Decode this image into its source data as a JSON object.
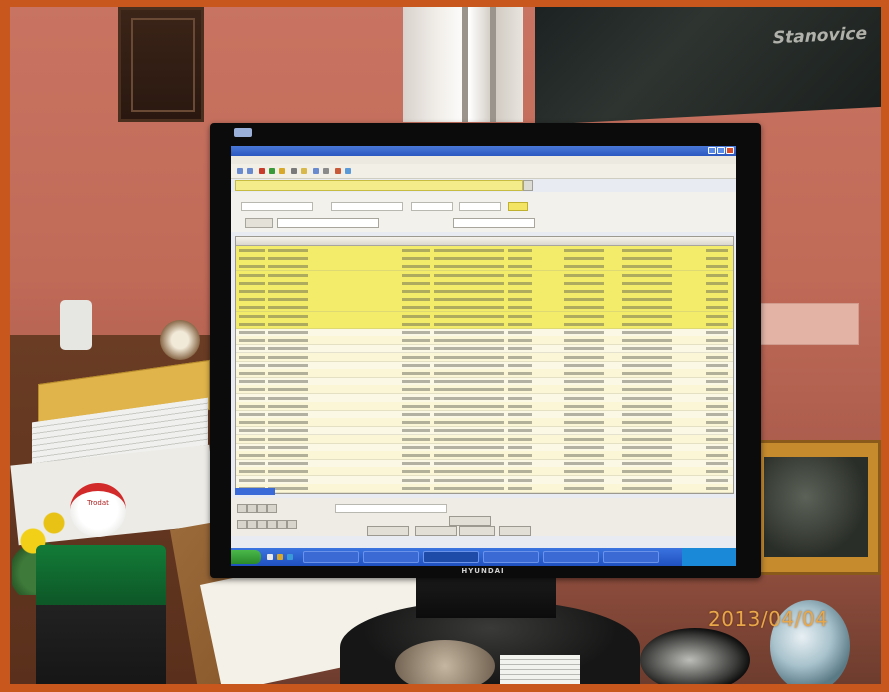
{
  "photo": {
    "date_stamp": "2013/04/04"
  },
  "wall_map": {
    "label": "Stanovice"
  },
  "stamp": {
    "brand": "Trodat"
  },
  "monitor": {
    "brand": "HYUNDAI"
  },
  "colors": {
    "highlight_row": "#f3ec6a",
    "taskbar": "#2a5ccc",
    "frame": "#c8571d"
  },
  "screen": {
    "rows_total": 30,
    "rows_highlighted": 10
  }
}
